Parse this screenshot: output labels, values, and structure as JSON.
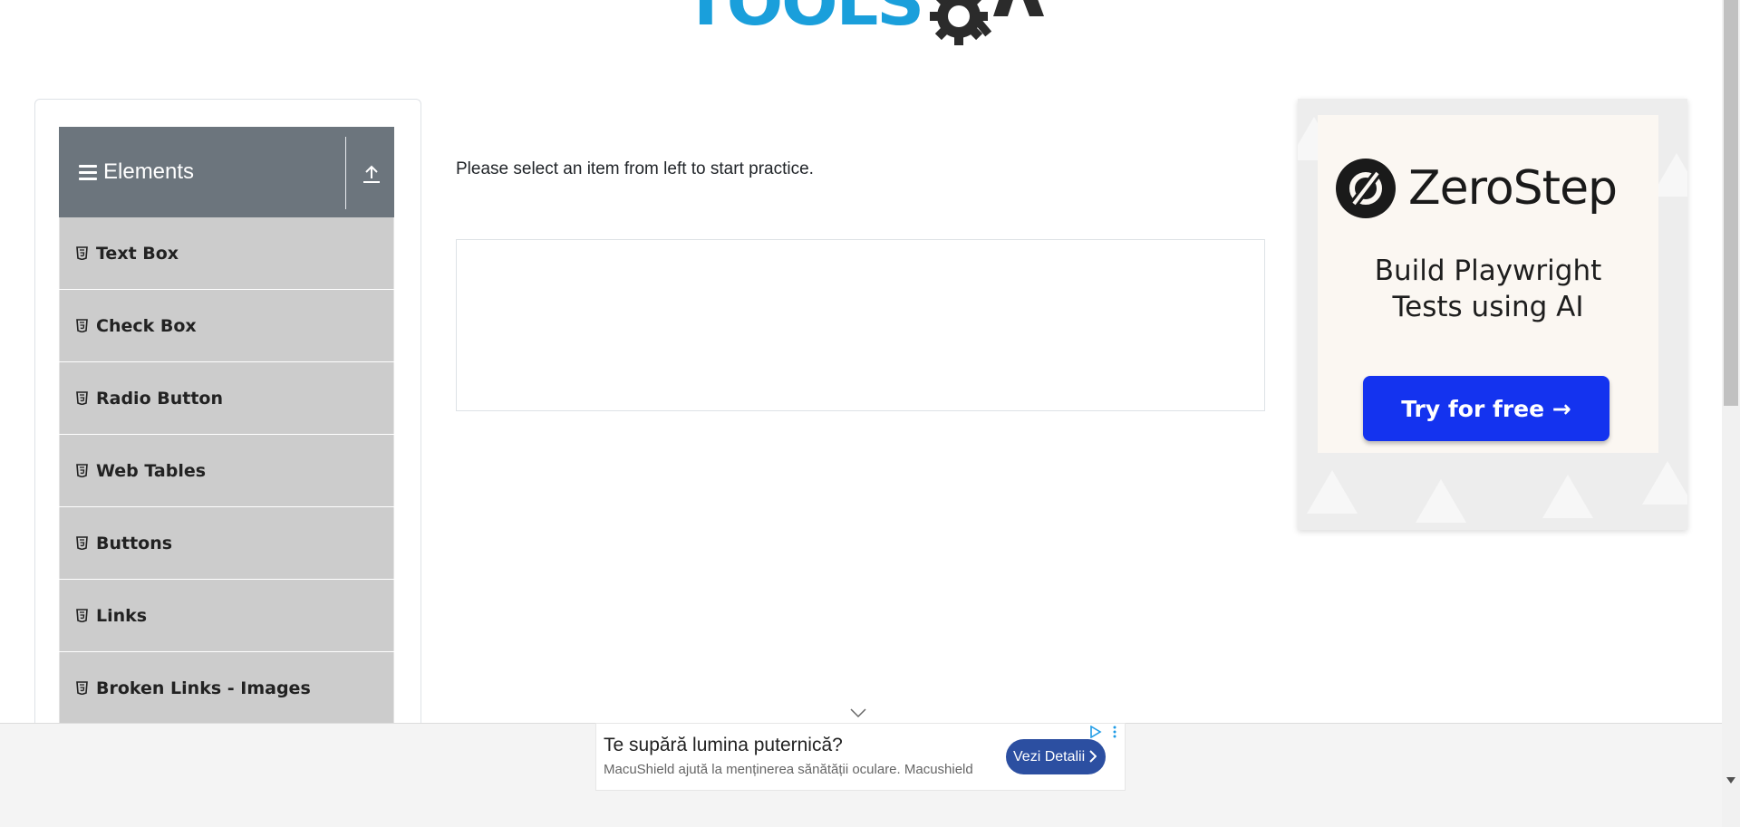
{
  "logo": {
    "word_tools": "TOOLS",
    "word_qa": "QA"
  },
  "sidebar": {
    "group_title": "Elements",
    "items": [
      {
        "label": "Text Box"
      },
      {
        "label": "Check Box"
      },
      {
        "label": "Radio Button"
      },
      {
        "label": "Web Tables"
      },
      {
        "label": "Buttons"
      },
      {
        "label": "Links"
      },
      {
        "label": "Broken Links - Images"
      }
    ]
  },
  "main": {
    "instruction": "Please select an item from left to start practice."
  },
  "right_ad": {
    "brand": "ZeroStep",
    "headline_line1": "Build Playwright",
    "headline_line2": "Tests using AI",
    "cta": "Try for free →"
  },
  "bottom_ad": {
    "title": "Te supără lumina puternică?",
    "description": "MacuShield ajută la menținerea sănătății oculare. Macushield",
    "cta": "Vezi Detalii"
  },
  "colors": {
    "header_gray": "#6c757d",
    "menu_item_gray": "#cccccc",
    "logo_blue": "#1a9fdb",
    "zerostep_button": "#1433ef",
    "bottom_cta": "#2c4fa1"
  },
  "icons": {
    "menu": "hamburger-icon",
    "collapse": "upload-arrow-icon",
    "item": "html5-icon"
  }
}
